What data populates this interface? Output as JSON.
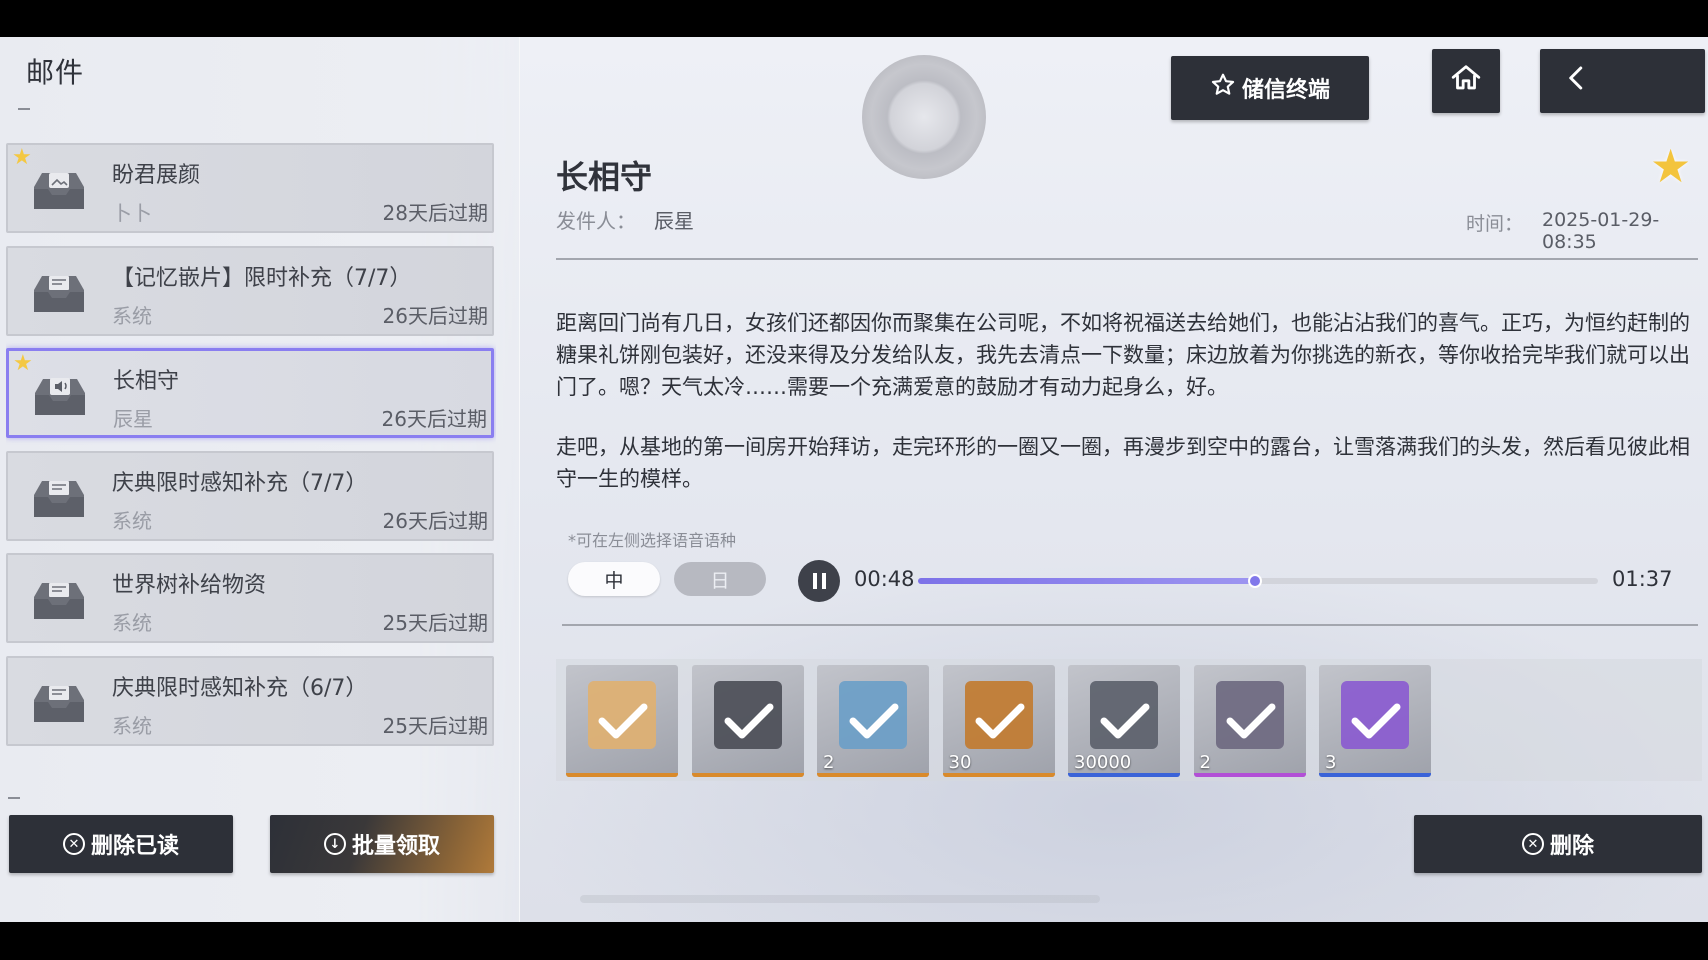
{
  "header": {
    "mail_title": "邮件"
  },
  "mail_list": [
    {
      "subject": "盼君展颜",
      "sender": "卜卜",
      "expire": "28天后过期",
      "starred": true,
      "icon": "photo-mail-icon",
      "selected": false
    },
    {
      "subject": "【记忆嵌片】限时补充（7/7）",
      "sender": "系统",
      "expire": "26天后过期",
      "starred": false,
      "icon": "mail-tray-icon",
      "selected": false
    },
    {
      "subject": "长相守",
      "sender": "辰星",
      "expire": "26天后过期",
      "starred": true,
      "icon": "voice-mail-icon",
      "selected": true
    },
    {
      "subject": "庆典限时感知补充（7/7）",
      "sender": "系统",
      "expire": "26天后过期",
      "starred": false,
      "icon": "mail-tray-icon",
      "selected": false
    },
    {
      "subject": "世界树补给物资",
      "sender": "系统",
      "expire": "25天后过期",
      "starred": false,
      "icon": "mail-tray-icon",
      "selected": false
    },
    {
      "subject": "庆典限时感知补充（6/7）",
      "sender": "系统",
      "expire": "25天后过期",
      "starred": false,
      "icon": "mail-tray-icon",
      "selected": false
    }
  ],
  "left_buttons": {
    "delete_read": "删除已读",
    "batch_claim": "批量领取"
  },
  "top_buttons": {
    "terminal": "储信终端",
    "home_icon": "home-icon",
    "back_icon": "back-arrow-icon"
  },
  "detail": {
    "title": "长相守",
    "sender_label": "发件人：",
    "sender": "辰星",
    "time_label": "时间：",
    "time": "2025-01-29-08:35",
    "paragraph_1": "距离回门尚有几日，女孩们还都因你而聚集在公司呢，不如将祝福送去给她们，也能沾沾我们的喜气。正巧，为恒约赶制的糖果礼饼刚包装好，还没来得及分发给队友，我先去清点一下数量；床边放着为你挑选的新衣，等你收拾完毕我们就可以出门了。嗯？天气太冷……需要一个充满爱意的鼓励才有动力起身么，好。",
    "paragraph_2": "走吧，从基地的第一间房开始拜访，走完环形的一圈又一圈，再漫步到空中的露台，让雪落满我们的头发，然后看见彼此相守一生的模样。",
    "starred": true
  },
  "voice": {
    "hint": "*可在左侧选择语音语种",
    "lang_zh": "中",
    "lang_jp": "日",
    "current_time": "00:48",
    "total_time": "01:37",
    "progress": 0.495
  },
  "attachments": [
    {
      "qty": "",
      "claimed": true,
      "rarity_color": "#d98a2b",
      "art_color": "#e0b070"
    },
    {
      "qty": "",
      "claimed": true,
      "rarity_color": "#d98a2b",
      "art_color": "#4a4c55"
    },
    {
      "qty": "2",
      "claimed": true,
      "rarity_color": "#d98a2b",
      "art_color": "#6a9ec8"
    },
    {
      "qty": "30",
      "claimed": true,
      "rarity_color": "#d98a2b",
      "art_color": "#c27a2e"
    },
    {
      "qty": "30000",
      "claimed": true,
      "rarity_color": "#3a63d8",
      "art_color": "#5b5f6a"
    },
    {
      "qty": "2",
      "claimed": true,
      "rarity_color": "#b24fd6",
      "art_color": "#6d6880"
    },
    {
      "qty": "3",
      "claimed": true,
      "rarity_color": "#3a63d8",
      "art_color": "#8a5ad0"
    }
  ],
  "detail_buttons": {
    "delete": "删除"
  },
  "colors": {
    "accent": "#8a7ef0",
    "dark_button": "#2d3038",
    "star": "#f4c842"
  }
}
